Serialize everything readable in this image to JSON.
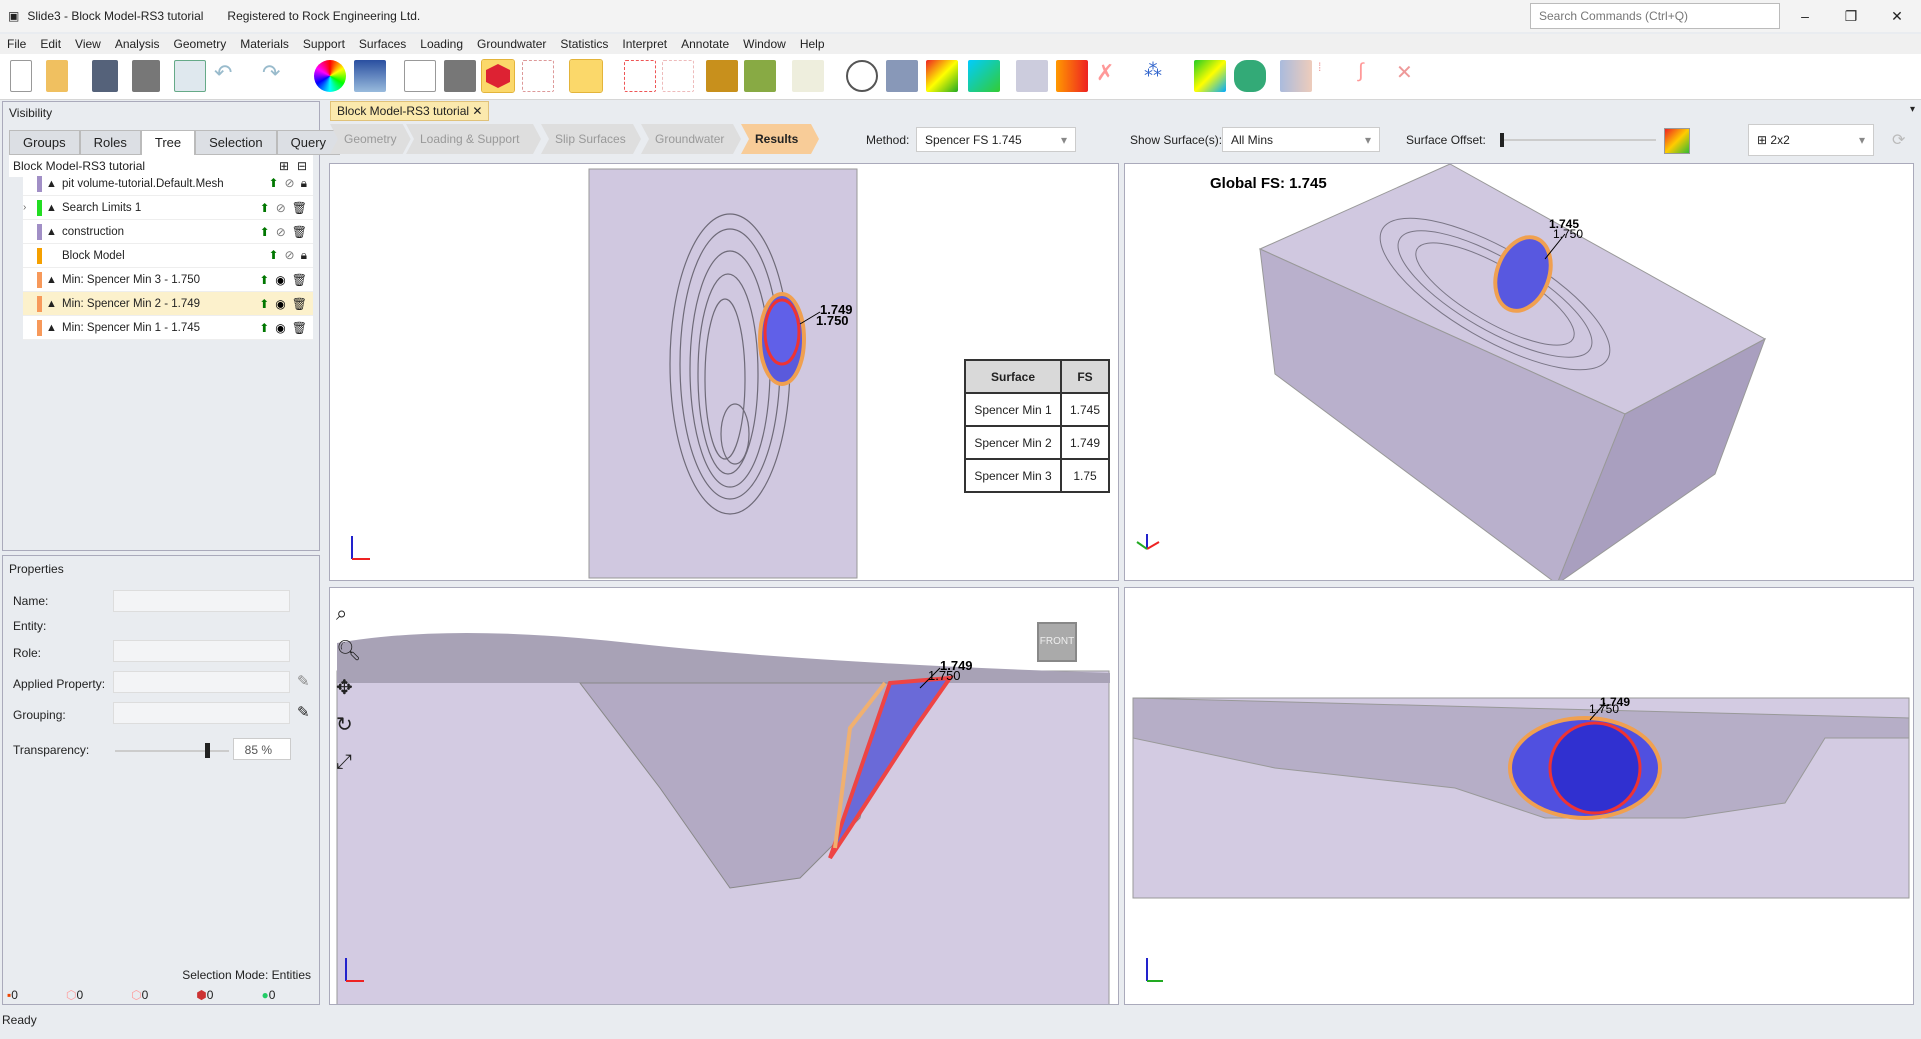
{
  "title": {
    "app": "Slide3 - Block Model-RS3 tutorial",
    "registered": "Registered to Rock Engineering Ltd.",
    "search_placeholder": "Search Commands (Ctrl+Q)"
  },
  "menu": [
    "File",
    "Edit",
    "View",
    "Analysis",
    "Geometry",
    "Materials",
    "Support",
    "Surfaces",
    "Loading",
    "Groundwater",
    "Statistics",
    "Interpret",
    "Annotate",
    "Window",
    "Help"
  ],
  "visibility": {
    "title": "Visibility",
    "tabs": [
      "Groups",
      "Roles",
      "Tree",
      "Selection",
      "Query"
    ],
    "active_tab": "Tree",
    "root": "Block Model-RS3 tutorial",
    "items": [
      {
        "label": "pit volume-tutorial.Default.Mesh",
        "color": "#a18fc6",
        "icon": "mesh-icon",
        "visible": false,
        "locked": true
      },
      {
        "label": "Search Limits 1",
        "color": "#22dd22",
        "icon": "search-limits-icon",
        "visible": false,
        "locked": false
      },
      {
        "label": "construction",
        "color": "#a18fc6",
        "icon": "hammer-icon",
        "visible": false,
        "locked": false
      },
      {
        "label": "Block Model",
        "color": "#f5a000",
        "icon": "",
        "visible": false,
        "locked": true
      },
      {
        "label": "Min: Spencer Min 3  -  1.750",
        "color": "#f7995a",
        "icon": "surface-icon",
        "visible": true,
        "locked": false
      },
      {
        "label": "Min: Spencer Min 2  -  1.749",
        "color": "#f7995a",
        "icon": "surface-icon",
        "visible": true,
        "locked": false,
        "selected": true
      },
      {
        "label": "Min: Spencer Min 1  -  1.745",
        "color": "#f7995a",
        "icon": "surface-icon",
        "visible": true,
        "locked": false
      }
    ]
  },
  "properties": {
    "title": "Properties",
    "name": "Name:",
    "entity": "Entity:",
    "role": "Role:",
    "applied": "Applied Property:",
    "grouping": "Grouping:",
    "transparency": "Transparency:",
    "transparency_value": "85 %",
    "transparency_pct": 85,
    "selection_mode": "Selection Mode:  Entities",
    "counts": [
      "0",
      "0",
      "0",
      "0",
      "0"
    ]
  },
  "status": "Ready",
  "doc_tab": "Block Model-RS3 tutorial",
  "workflow": [
    "Geometry",
    "Loading & Support",
    "Slip Surfaces",
    "Groundwater",
    "Results"
  ],
  "controls": {
    "method_label": "Method:",
    "method_value": "Spencer FS    1.745",
    "show_label": "Show Surface(s):",
    "show_value": "All Mins",
    "offset_label": "Surface Offset:",
    "layout_value": "2x2"
  },
  "views": {
    "global_fs": "Global FS: 1.745",
    "labels": [
      "1.749",
      "1.750",
      "1.745"
    ],
    "front": "FRONT",
    "table": {
      "headers": [
        "Surface",
        "FS"
      ],
      "rows": [
        [
          "Spencer Min 1",
          "1.745"
        ],
        [
          "Spencer Min 2",
          "1.749"
        ],
        [
          "Spencer Min 3",
          "1.75"
        ]
      ]
    }
  }
}
